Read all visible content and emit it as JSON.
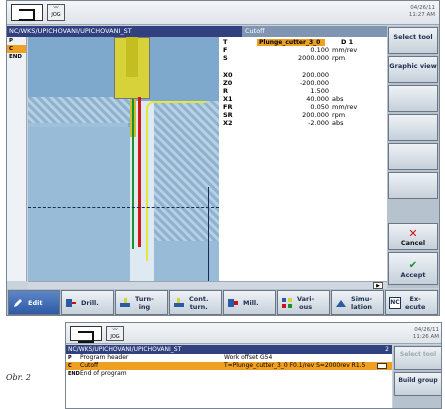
{
  "screen1": {
    "datetime": [
      "04/26/11",
      "11:27 AM"
    ],
    "path": "NC/WKS/UPICHOVANI/UPICHOVANI_ST",
    "dialog_title": "Cutoff",
    "gutter": [
      "P",
      "C",
      "END"
    ],
    "params": [
      {
        "name": "T",
        "value": "Plunge_cutter_3_0",
        "unit": "",
        "extra": "D 1"
      },
      {
        "name": "F",
        "value": "0.100",
        "unit": "mm/rev"
      },
      {
        "name": "S",
        "value": "2000.000",
        "unit": "rpm"
      },
      {
        "name": "X0",
        "value": "200.000",
        "unit": ""
      },
      {
        "name": "Z0",
        "value": "-200.000",
        "unit": ""
      },
      {
        "name": "R",
        "value": "1.500",
        "unit": ""
      },
      {
        "name": "X1",
        "value": "40.000",
        "unit": "abs"
      },
      {
        "name": "FR",
        "value": "0.050",
        "unit": "mm/rev"
      },
      {
        "name": "SR",
        "value": "200.000",
        "unit": "rpm"
      },
      {
        "name": "X2",
        "value": "-2.000",
        "unit": "abs"
      }
    ],
    "vsoft": {
      "select_tool": "Select tool",
      "graphic_view": "Graphic view",
      "cancel": "Cancel",
      "accept": "Accept"
    },
    "hsoft": {
      "edit": "Edit",
      "drill": "Drill.",
      "turning": [
        "Turn-",
        "ing"
      ],
      "cont_turn": [
        "Cont.",
        "turn."
      ],
      "mill": "Mill.",
      "various": [
        "Vari-",
        "ous"
      ],
      "simulation": [
        "Simu-",
        "lation"
      ],
      "execute": [
        "Ex-",
        "ecute"
      ],
      "nc_badge": "NC"
    }
  },
  "caption": "Obr. 2",
  "screen2": {
    "datetime": [
      "04/26/11",
      "11:26 AM"
    ],
    "path": "NC/WKS/UPICHOVANI/UPICHOVANI_ST",
    "line_no": "2",
    "rows": [
      {
        "icon": "P",
        "name": "Program header",
        "desc": "Work offset G54"
      },
      {
        "icon": "C",
        "name": "Cutoff",
        "desc": "T=Plunge_cutter_3_0 F0.1/rev S=2000rev R1.5"
      },
      {
        "icon": "END",
        "name": "End of program",
        "desc": ""
      }
    ],
    "select_tool": "Select tool",
    "build_group": "Build group"
  }
}
